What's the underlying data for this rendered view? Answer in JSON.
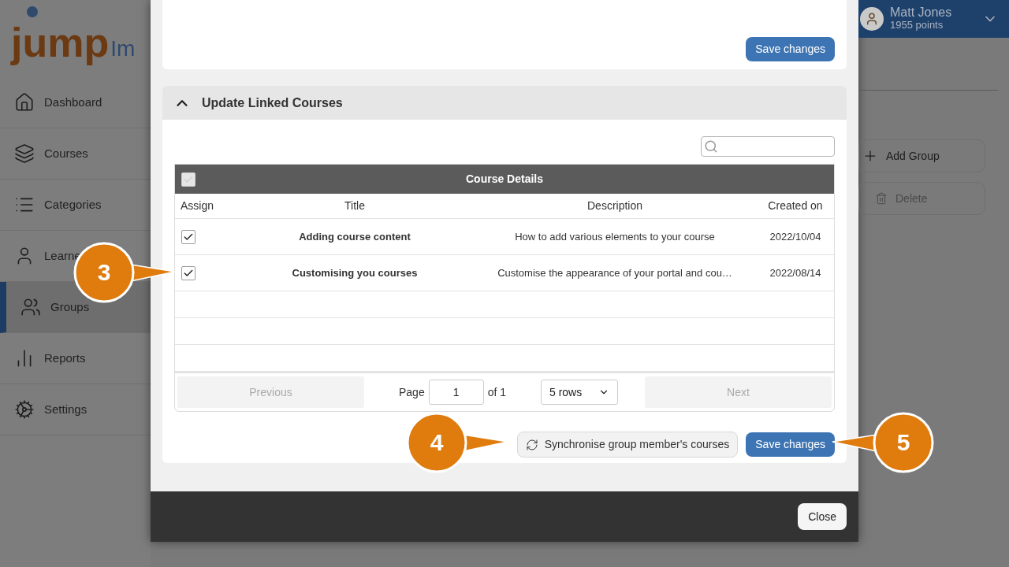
{
  "sidebar": {
    "logo": {
      "main": "jump",
      "tail": "Im"
    },
    "items": [
      {
        "label": "Dashboard",
        "selected": false
      },
      {
        "label": "Courses",
        "selected": false
      },
      {
        "label": "Categories",
        "selected": false
      },
      {
        "label": "Learne",
        "selected": false
      },
      {
        "label": "Groups",
        "selected": true
      },
      {
        "label": "Reports",
        "selected": false
      },
      {
        "label": "Settings",
        "selected": false
      }
    ]
  },
  "user": {
    "name": "Matt Jones",
    "points": "1955 points"
  },
  "actions": [
    {
      "kind": "add",
      "label": "Add Group",
      "disabled": false
    },
    {
      "kind": "delete",
      "label": "Delete",
      "disabled": true
    }
  ],
  "modal": {
    "top_save": "Save changes",
    "section": {
      "title": "Update Linked Courses",
      "expanded": true
    },
    "table": {
      "select_all": {
        "checked": true,
        "disabled": true
      },
      "caption": "Course Details",
      "columns": [
        "Assign",
        "Title",
        "Description",
        "Created on"
      ],
      "rows": [
        {
          "checked": true,
          "title": "Adding course content",
          "description": "How to add various elements to your course",
          "created": "2022/10/04"
        },
        {
          "checked": true,
          "title": "Customising you courses",
          "description": "Customise the appearance of your portal and cou…",
          "created": "2022/08/14"
        }
      ],
      "pagination": {
        "previous": {
          "label": "Previous",
          "disabled": true
        },
        "page_label": "Page",
        "page": "1",
        "of": "of 1",
        "rows": "5 rows",
        "next": {
          "label": "Next",
          "disabled": true
        }
      }
    },
    "sync_button": "Synchronise group member's courses",
    "save_button": "Save changes",
    "close_button": "Close"
  },
  "callouts": [
    {
      "number": "3"
    },
    {
      "number": "4"
    },
    {
      "number": "5"
    }
  ]
}
